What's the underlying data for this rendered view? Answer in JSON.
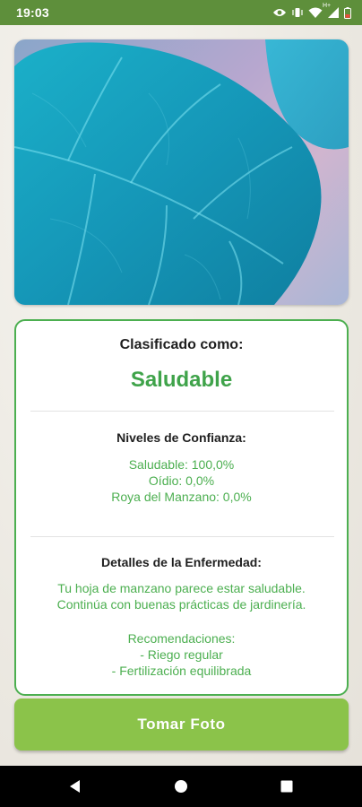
{
  "status_bar": {
    "time": "19:03",
    "icons": [
      "eye-icon",
      "vibrate-icon",
      "wifi-icon",
      "signal-icon",
      "battery-icon"
    ],
    "network_label": "H+"
  },
  "photo": {
    "subject": "leaf"
  },
  "result_card": {
    "title": "Clasificado como:",
    "result": "Saludable",
    "confidence": {
      "title": "Niveles de Confianza:",
      "lines": [
        "Saludable: 100,0%",
        "Oídio: 0,0%",
        "Roya del Manzano: 0,0%"
      ]
    },
    "details": {
      "title": "Detalles de la Enfermedad:",
      "lines": [
        "Tu hoja de manzano parece estar saludable.",
        "Continúa con buenas prácticas de jardinería.",
        "",
        "Recomendaciones:",
        "- Riego regular",
        "- Fertilización equilibrada"
      ]
    }
  },
  "actions": {
    "take_photo": "Tomar Foto"
  },
  "nav_bar": {
    "icons": [
      "back-icon",
      "home-icon",
      "recents-icon"
    ]
  },
  "colors": {
    "status_bar": "#5e8f3b",
    "accent_green": "#4caf50",
    "result_green": "#3fa34a",
    "button_green": "#8bc34a"
  }
}
